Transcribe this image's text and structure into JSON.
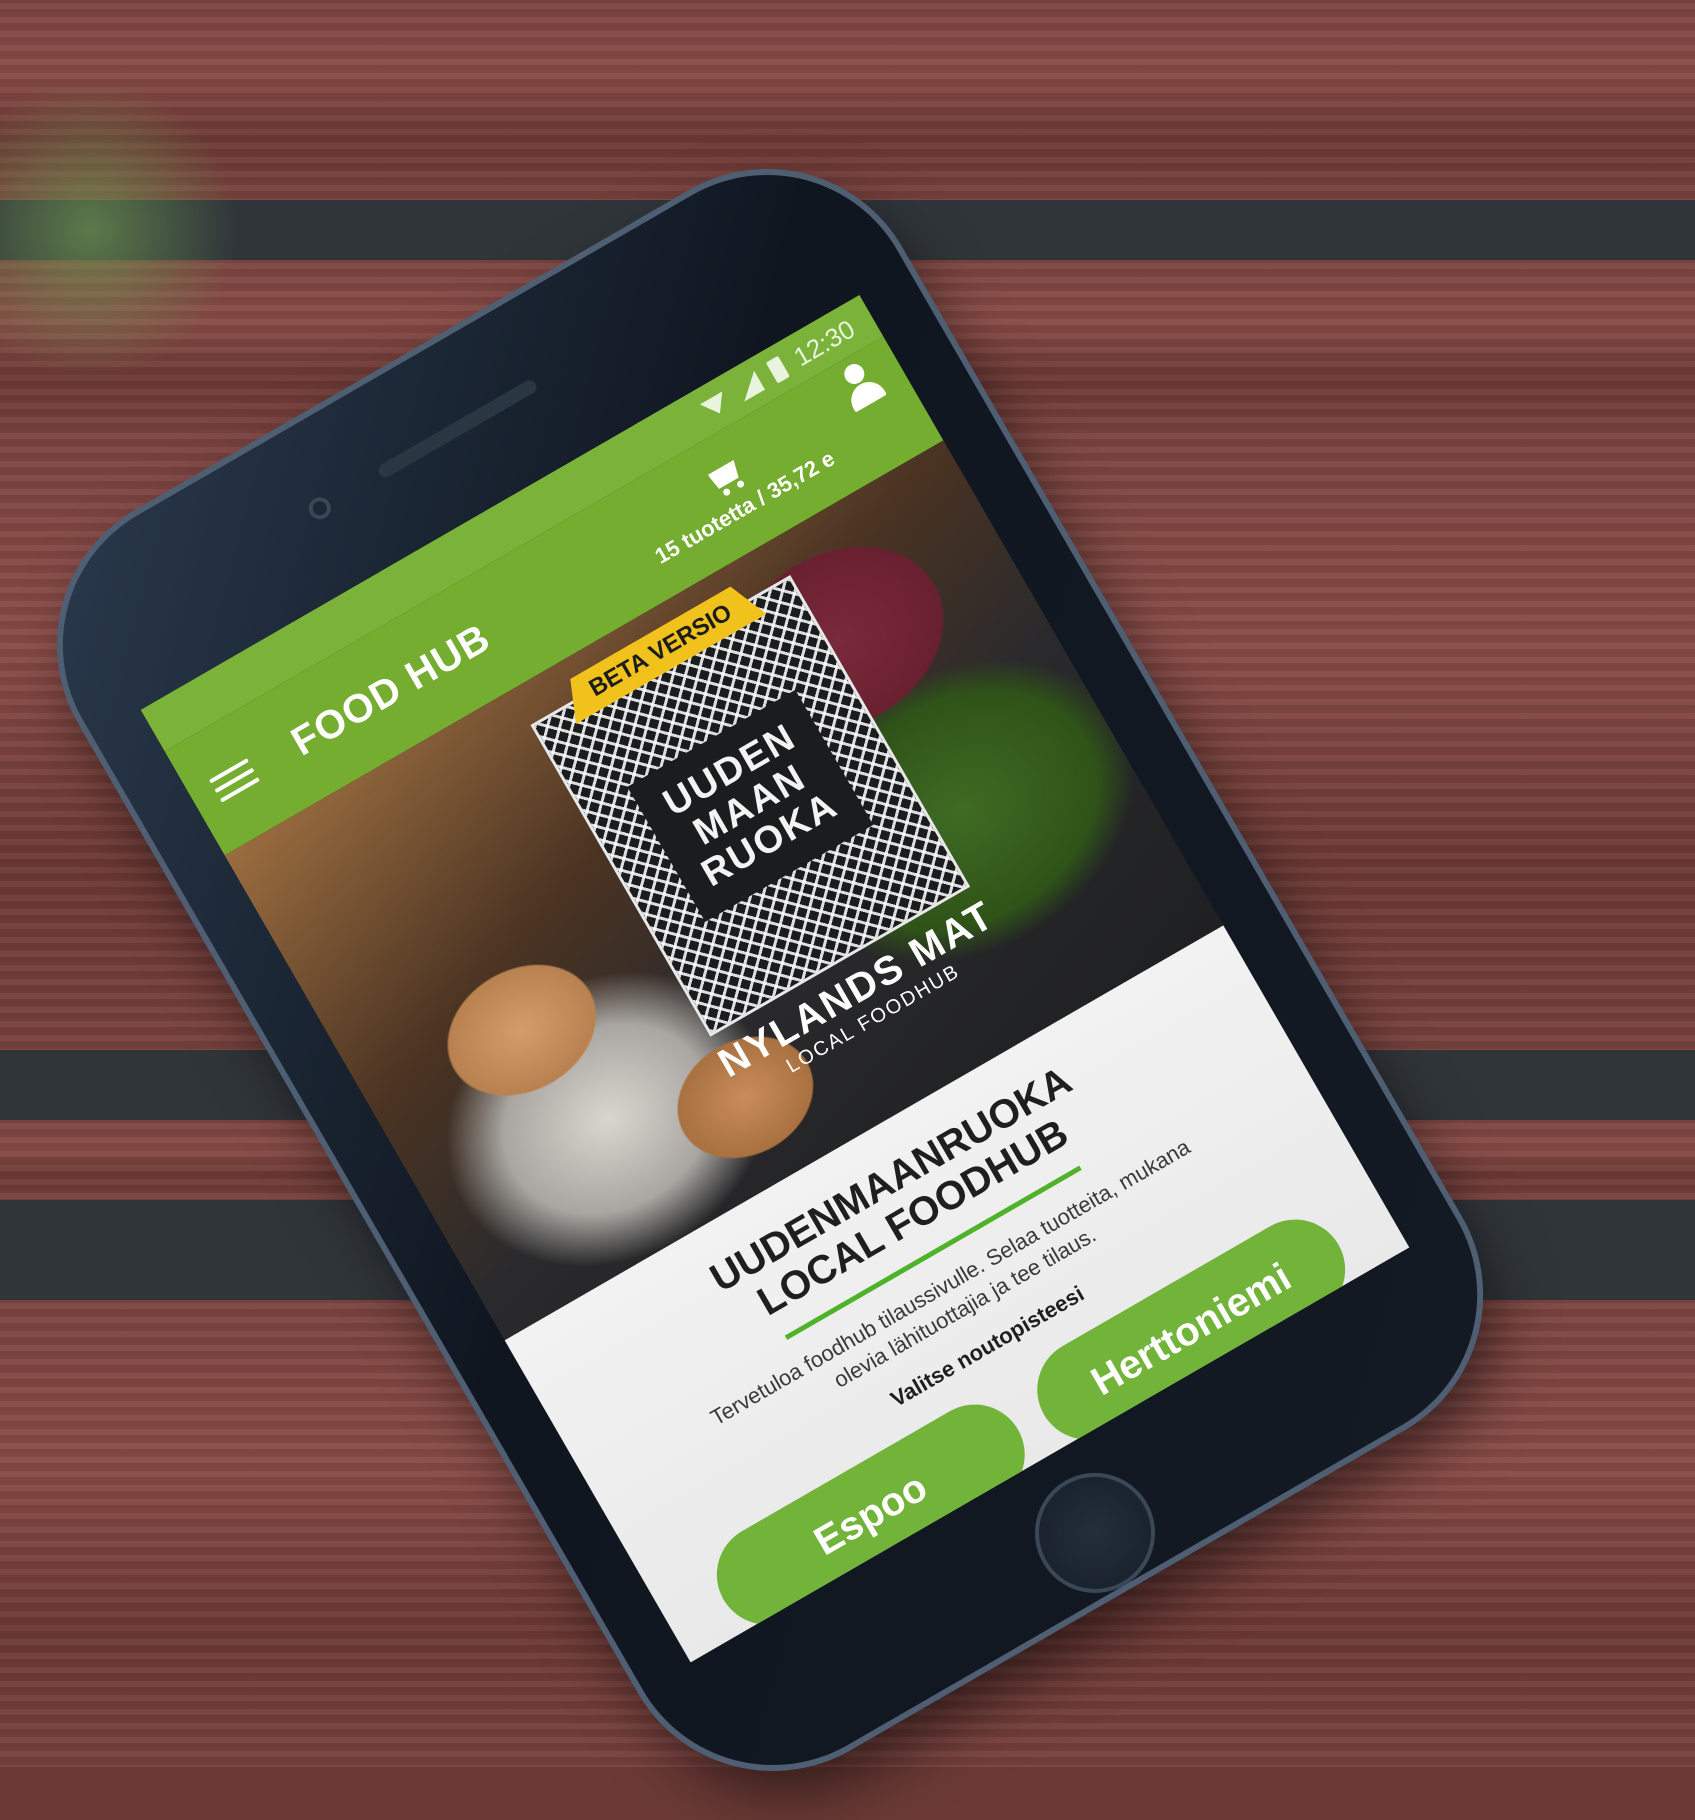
{
  "status_bar": {
    "time": "12:30"
  },
  "app_bar": {
    "title": "FOOD HUB",
    "cart_summary": "15 tuotetta / 35,72 e"
  },
  "hero": {
    "beta_label": "BETA VERSIO",
    "logo_lines": [
      "UUDEN",
      "MAAN",
      "RUOKA"
    ],
    "logo_name": "NYLANDS MAT",
    "logo_tagline": "LOCAL FOODHUB"
  },
  "card": {
    "title_line1": "UUDENMAANRUOKA",
    "title_line2": "LOCAL FOODHUB",
    "body": "Tervetuloa foodhub tilaussivulle. Selaa tuotteita, mukana olevia lähituottajia ja tee tilaus.",
    "prompt": "Valitse noutopisteesi",
    "buttons": [
      "Espoo",
      "Herttoniemi"
    ]
  },
  "colors": {
    "brand_green": "#74ad2f",
    "beta_yellow": "#f1c21b",
    "card_bg": "#f2f2f2"
  }
}
